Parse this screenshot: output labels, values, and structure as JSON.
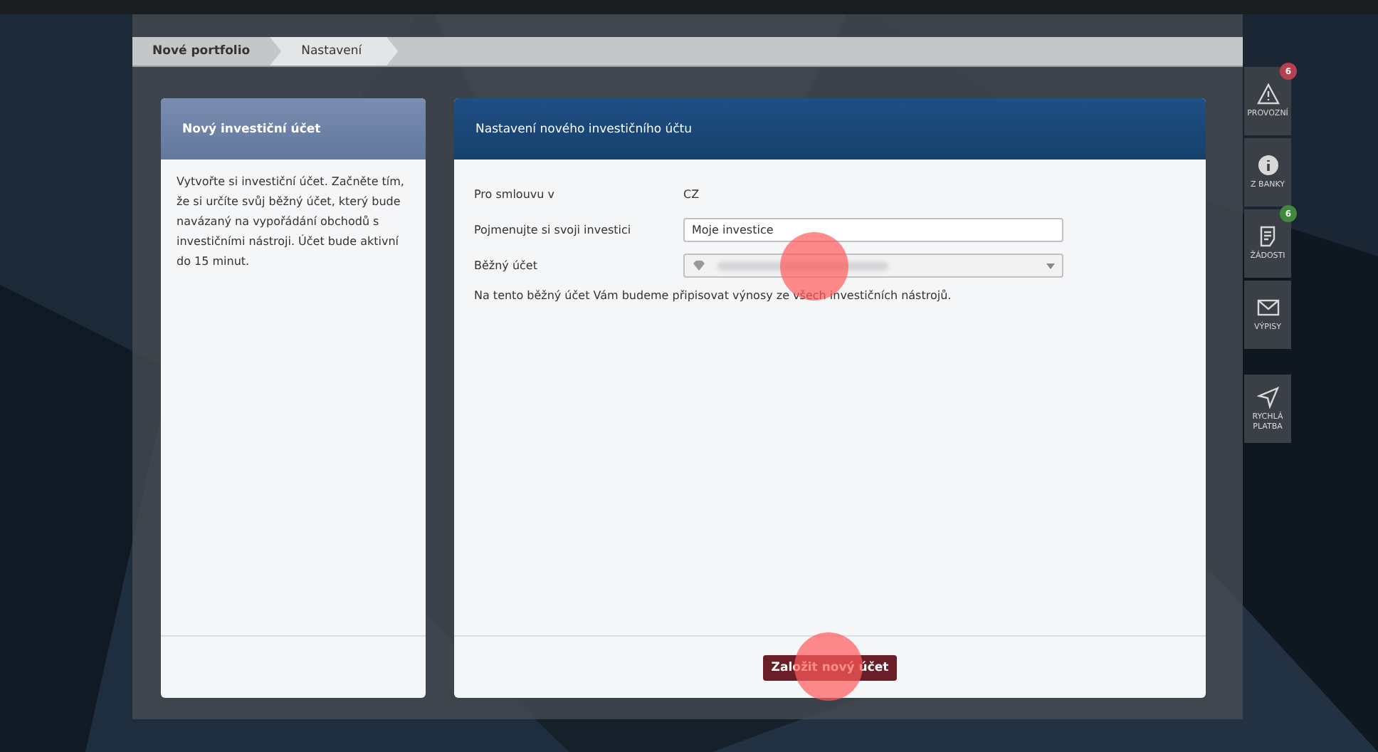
{
  "breadcrumb": [
    {
      "label": "Nové portfolio",
      "selected": true
    },
    {
      "label": "Nastavení",
      "selected": false
    }
  ],
  "info_card": {
    "title": "Nový investiční účet",
    "text": "Vytvořte si investiční účet. Začněte tím, že si určíte svůj běžný účet, který bude navázaný na vypořádání obchodů s investičními nástroji. Účet bude aktivní do 15 minut."
  },
  "form_card": {
    "title": "Nastavení nového investičního účtu",
    "rows": [
      {
        "kind": "text",
        "label": "Pro smlouvu v",
        "value": "CZ"
      },
      {
        "kind": "input",
        "label": "Pojmenujte si svoji investici",
        "value": "Moje investice"
      },
      {
        "kind": "select",
        "label": "Běžný účet"
      }
    ],
    "note": "Na tento běžný účet Vám budeme připisovat výnosy ze všech investičních nástrojů.",
    "submit": "Založit nový účet"
  },
  "side_menu": [
    {
      "kind": "warning",
      "label": "PROVOZNÍ",
      "badge": "6",
      "color": "#b5404f"
    },
    {
      "kind": "info",
      "label": "Z BANKY"
    },
    {
      "kind": "document",
      "label": "ŽÁDOSTI",
      "badge": "6",
      "color": "#3f8a3a"
    },
    {
      "kind": "mail",
      "label": "VÝPISY"
    },
    {
      "kind": "send",
      "label": "RYCHLÁ PLATBA"
    }
  ]
}
